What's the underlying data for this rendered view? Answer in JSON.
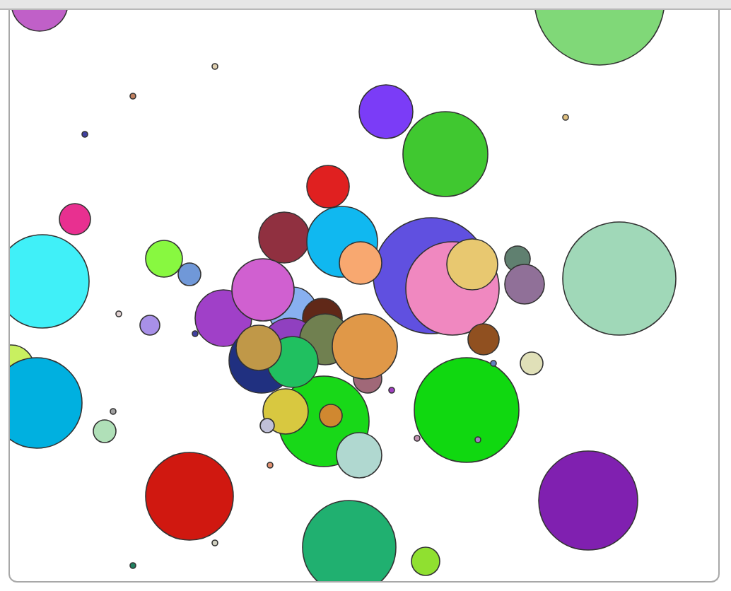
{
  "canvas": {
    "circles": [
      {
        "color": "#c060c8"
      },
      {
        "color": "#80d878"
      },
      {
        "color": "#7b3cf7"
      },
      {
        "color": "#40c830"
      },
      {
        "color": "#e02020"
      },
      {
        "color": "#e83090"
      },
      {
        "color": "#40f0f8"
      },
      {
        "color": "#88f840"
      },
      {
        "color": "#7098d8"
      },
      {
        "color": "#903040"
      },
      {
        "color": "#10b8f0"
      },
      {
        "color": "#6050e0"
      },
      {
        "color": "#f088c0"
      },
      {
        "color": "#e8c870"
      },
      {
        "color": "#f8a870"
      },
      {
        "color": "#608070"
      },
      {
        "color": "#907098"
      },
      {
        "color": "#a0d8b8"
      },
      {
        "color": "#a040c8"
      },
      {
        "color": "#a890e8"
      },
      {
        "color": "#905020"
      },
      {
        "color": "#e0e0b8"
      },
      {
        "color": "#88b0f0"
      },
      {
        "color": "#602818"
      },
      {
        "color": "#d060d0"
      },
      {
        "color": "#203080"
      },
      {
        "color": "#9040c0"
      },
      {
        "color": "#708050"
      },
      {
        "color": "#18d818"
      },
      {
        "color": "#a06878"
      },
      {
        "color": "#e09848"
      },
      {
        "color": "#20c060"
      },
      {
        "color": "#c09848"
      },
      {
        "color": "#10d810"
      },
      {
        "color": "#d8c840"
      },
      {
        "color": "#d08830"
      },
      {
        "color": "#b0d8d0"
      },
      {
        "color": "#c8f060"
      },
      {
        "color": "#00b0e0"
      },
      {
        "color": "#b0e0b8"
      },
      {
        "color": "#d01810"
      },
      {
        "color": "#20b070"
      },
      {
        "color": "#8020b0"
      },
      {
        "color": "#90e030"
      },
      {
        "color": "#c0c0d8"
      },
      {
        "color": "#e0d0b0"
      },
      {
        "color": "#c08060"
      },
      {
        "color": "#4040a0"
      },
      {
        "color": "#e0c080"
      },
      {
        "color": "#e0d0d0"
      },
      {
        "color": "#4040a0"
      },
      {
        "color": "#a040c0"
      },
      {
        "color": "#a0a0a0"
      },
      {
        "color": "#c090b0"
      },
      {
        "color": "#a080c0"
      },
      {
        "color": "#e09070"
      },
      {
        "color": "#d0d0c0"
      },
      {
        "color": "#208060"
      },
      {
        "color": "#6080c0"
      }
    ]
  }
}
